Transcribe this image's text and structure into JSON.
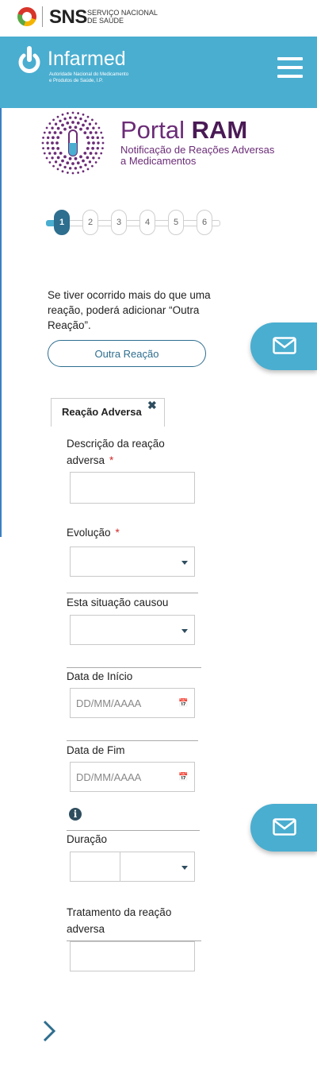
{
  "sns": {
    "name": "SNS",
    "subtitle_line1": "Serviço Nacional",
    "subtitle_line2": "de Saúde"
  },
  "header": {
    "brand": "Infarmed",
    "subtitle_line1": "Autoridade Nacional do Medicamento",
    "subtitle_line2": "e Produtos de Saúde, I.P.",
    "menu_icon": "hamburger-menu-icon"
  },
  "portal": {
    "title_light": "Portal",
    "title_bold": "RAM",
    "subtitle_line1": "Notificação de Reações Adversas",
    "subtitle_line2": "a Medicamentos"
  },
  "stepper": {
    "steps": [
      "1",
      "2",
      "3",
      "4",
      "5",
      "6"
    ],
    "active_step": "1"
  },
  "intro_text": "Se tiver ocorrido mais do que uma reação, poderá adicionar “Outra Reação”.",
  "add_reaction_button": "Outra Reação",
  "mail_icon": "envelope-icon",
  "tab": {
    "label": "Reação Adversa",
    "close_symbol": "✖"
  },
  "form": {
    "descricao_line1": "Descrição da reação",
    "descricao_line2": "adversa",
    "required_mark": "*",
    "evolucao": "Evolução",
    "situacao": "Esta situação causou",
    "data_inicio": "Data de Início",
    "data_fim": "Data de Fim",
    "date_placeholder": "DD/MM/AAAA",
    "info_symbol": "i",
    "duracao": "Duração",
    "tratamento_line1": "Tratamento da reação",
    "tratamento_line2": "adversa"
  },
  "colors": {
    "header_bg": "#4aaed0",
    "primary_dark": "#2e6e8e",
    "portal_purple": "#6b2c77",
    "required_red": "#d32a2a"
  }
}
